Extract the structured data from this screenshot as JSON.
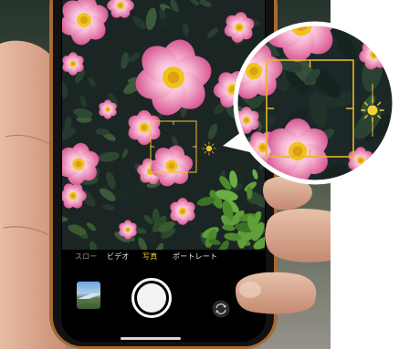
{
  "camera": {
    "modes": [
      "スロー",
      "ビデオ",
      "写真",
      "ポートレート"
    ],
    "selected_index": 2
  },
  "icons": {
    "exposure": "sun-icon",
    "focus": "focus-box-icon",
    "flip": "camera-flip-icon",
    "shutter": "shutter-button"
  },
  "colors": {
    "accent": "#f2c230",
    "phone_rim": "#a86a33",
    "mode_text": "#e6e6e6",
    "skin": "#dcae93"
  }
}
